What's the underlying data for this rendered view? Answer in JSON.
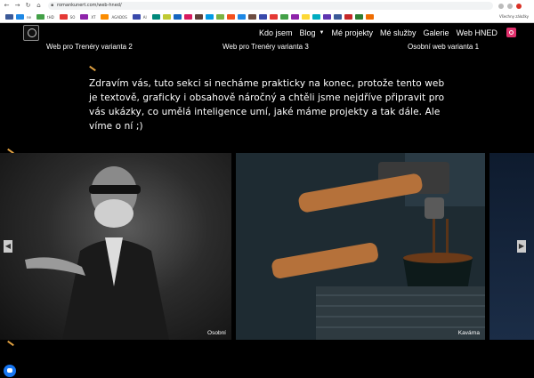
{
  "browser": {
    "url": "romankunert.com/web-hned/",
    "bookmarks_right": "Všechny záložky",
    "bookmark_labels": [
      "ne",
      "tHD",
      "SO",
      "XT",
      "AGADOS",
      "AI"
    ]
  },
  "header": {
    "menu": [
      {
        "label": "Kdo jsem"
      },
      {
        "label": "Blog",
        "has_dropdown": true
      },
      {
        "label": "Mé projekty"
      },
      {
        "label": "Mé služby"
      },
      {
        "label": "Galerie"
      },
      {
        "label": "Web HNED"
      }
    ],
    "instagram_icon": "instagram-icon",
    "colors": {
      "accent": "#e0a040",
      "instagram": "#e1306c"
    }
  },
  "carousel_top": {
    "labels": [
      "Web pro Trenéry varianta 2",
      "Web pro Trenéry varianta 3",
      "Osobní web varianta 1"
    ]
  },
  "intro": {
    "text": "Zdravím vás, tuto sekci si necháme prakticky na konec, protože tento web je textově, graficky i obsahově náročný a chtěli jsme nejdříve připravit pro vás ukázky, co umělá inteligence umí, jaké máme projekty a tak dále. Ale víme o ní ;)"
  },
  "slider": {
    "slides": [
      {
        "caption": "Osobní"
      },
      {
        "caption": "Kavárna"
      },
      {
        "caption": ""
      }
    ],
    "prev_icon": "chevron-left-icon",
    "next_icon": "chevron-right-icon"
  },
  "chat": {
    "icon": "messenger-icon"
  }
}
